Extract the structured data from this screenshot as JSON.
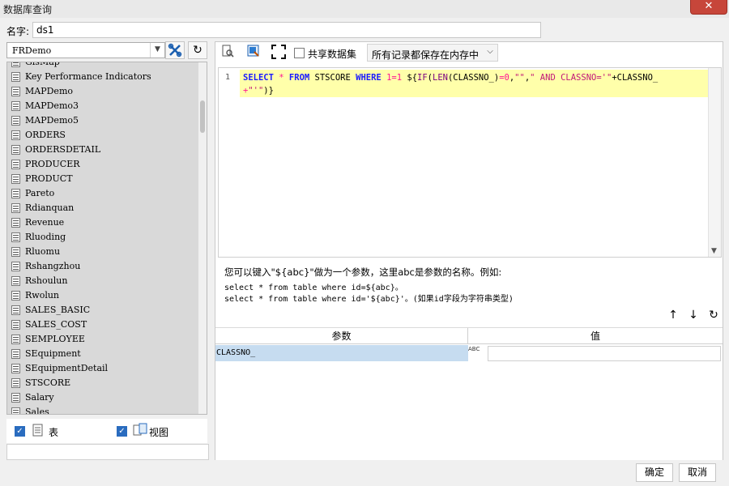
{
  "window": {
    "title": "数据库查询",
    "close_label": "✕"
  },
  "name_field": {
    "label": "名字:",
    "value": "ds1"
  },
  "left_pane": {
    "datasource": "FRDemo",
    "tables": [
      "GisMap",
      "Key Performance Indicators",
      "MAPDemo",
      "MAPDemo3",
      "MAPDemo5",
      "ORDERS",
      "ORDERSDETAIL",
      "PRODUCER",
      "PRODUCT",
      "Pareto",
      "Rdianquan",
      "Revenue",
      "Rluoding",
      "Rluomu",
      "Rshangzhou",
      "Rshoulun",
      "Rwolun",
      "SALES_BASIC",
      "SALES_COST",
      "SEMPLOYEE",
      "SEquipment",
      "SEquipmentDetail",
      "STSCORE",
      "Salary",
      "Sales"
    ],
    "filter_table_label": "表",
    "filter_view_label": "视图"
  },
  "toolbar": {
    "share_label": "共享数据集",
    "memory_select": "所有记录都保存在内存中"
  },
  "editor": {
    "line_number": "1",
    "line1": [
      {
        "t": "SELECT",
        "c": "kw"
      },
      {
        "t": " ",
        "c": "plain"
      },
      {
        "t": "*",
        "c": "op"
      },
      {
        "t": " ",
        "c": "plain"
      },
      {
        "t": "FROM",
        "c": "kw"
      },
      {
        "t": " STSCORE ",
        "c": "plain"
      },
      {
        "t": "WHERE",
        "c": "kw"
      },
      {
        "t": " ",
        "c": "plain"
      },
      {
        "t": "1",
        "c": "num"
      },
      {
        "t": "=",
        "c": "op"
      },
      {
        "t": "1",
        "c": "num"
      },
      {
        "t": " ${",
        "c": "plain"
      },
      {
        "t": "IF",
        "c": "fn"
      },
      {
        "t": "(",
        "c": "plain"
      },
      {
        "t": "LEN",
        "c": "fn"
      },
      {
        "t": "(CLASSNO_)",
        "c": "plain"
      },
      {
        "t": "=",
        "c": "op"
      },
      {
        "t": "0",
        "c": "num"
      },
      {
        "t": ",",
        "c": "plain"
      },
      {
        "t": "\"\"",
        "c": "str"
      },
      {
        "t": ",",
        "c": "plain"
      },
      {
        "t": "\" AND CLASSNO='\"",
        "c": "str"
      },
      {
        "t": "+CLASSNO_",
        "c": "plain"
      }
    ],
    "line2": [
      {
        "t": "+",
        "c": "op"
      },
      {
        "t": "\"'\"",
        "c": "str"
      },
      {
        "t": ")}",
        "c": "plain"
      }
    ]
  },
  "hint": {
    "line1": "您可以键入\"${abc}\"做为一个参数，这里abc是参数的名称。例如:",
    "line2": "select * from table where id=${abc}。",
    "line3": "select * from table where id='${abc}'。(如果id字段为字符串类型)"
  },
  "params": {
    "header_name": "参数",
    "header_value": "值",
    "rows": [
      {
        "name": "CLASSNO_",
        "type_icon": "ABC",
        "value": ""
      }
    ]
  },
  "footer": {
    "ok_label": "确定",
    "cancel_label": "取消"
  }
}
